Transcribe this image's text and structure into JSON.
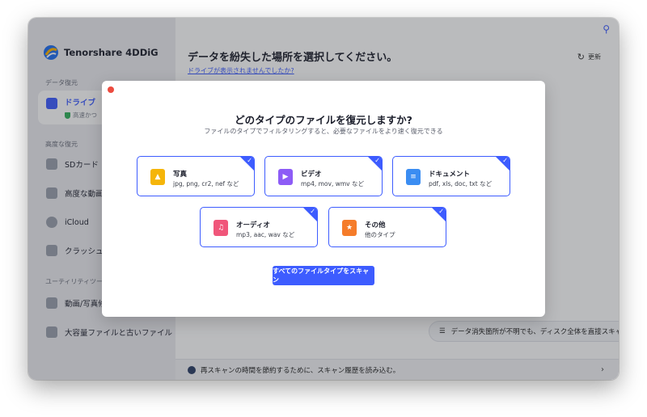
{
  "app": {
    "name": "Tenorshare 4DDiG"
  },
  "sidebar": {
    "section_recovery": "データ復元",
    "drive": {
      "label": "ドライブ",
      "sub": "高速かつ"
    },
    "section_advanced": "高度な復元",
    "sd_card": "SDカード",
    "video": "高度な動画復",
    "icloud": "iCloud",
    "crash": "クラッシュし",
    "section_utility": "ユーティリティツール",
    "photo_repair": "動画/写真修",
    "large_files": "大容量ファイルと古いファイル"
  },
  "main": {
    "title": "データを紛失した場所を選択してください。",
    "drive_link": "ドライブが表示されませんでしたか?",
    "refresh": "更新",
    "direct_scan": "データ消失箇所が不明でも、ディスク全体を直接スキャン",
    "bottom_bar": "再スキャンの時間を節約するために、スキャン履歴を読み込む。"
  },
  "modal": {
    "title": "どのタイプのファイルを復元しますか?",
    "subtitle": "ファイルのタイプでフィルタリングすると、必要なファイルをより速く復元できる",
    "cards": [
      {
        "name": "写真",
        "desc": "jpg, png, cr2, nef など",
        "icon": "image-icon",
        "color": "#f5b50a"
      },
      {
        "name": "ビデオ",
        "desc": "mp4, mov, wmv など",
        "icon": "video-icon",
        "color": "#8d5cf6"
      },
      {
        "name": "ドキュメント",
        "desc": "pdf, xls, doc, txt など",
        "icon": "document-icon",
        "color": "#3b8df2"
      },
      {
        "name": "オーディオ",
        "desc": "mp3, aac, wav など",
        "icon": "music-icon",
        "color": "#f0567a"
      },
      {
        "name": "その他",
        "desc": "他のタイプ",
        "icon": "star-icon",
        "color": "#f57c2a"
      }
    ],
    "scan_button": "すべてのファイルタイプをスキャン"
  },
  "colors": {
    "accent": "#3d5cff",
    "close": "#ec4b3f"
  }
}
